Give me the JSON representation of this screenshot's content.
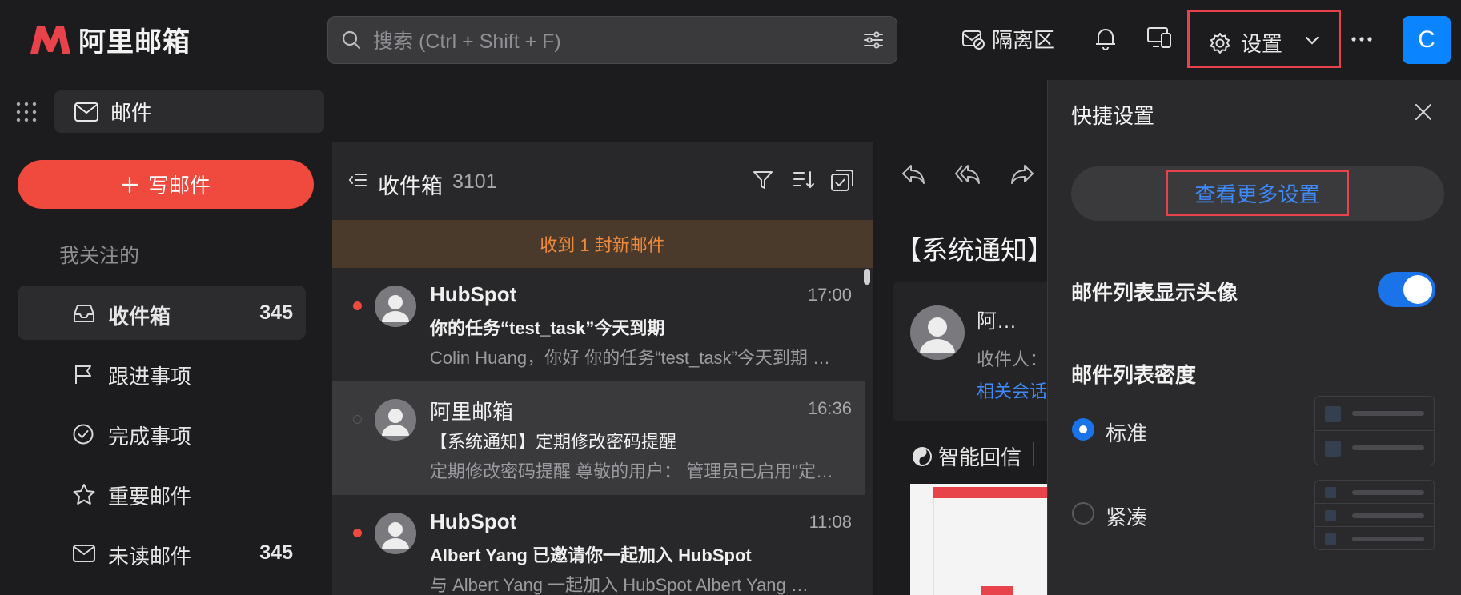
{
  "app": {
    "logo_text": "阿里邮箱",
    "brand_color": "#e8434b",
    "accent_color": "#1a73e8"
  },
  "topbar": {
    "search_placeholder": "搜索 (Ctrl + Shift + F)",
    "quarantine_label": "隔离区",
    "settings_label": "设置",
    "avatar_letter": "C"
  },
  "apptab": {
    "label": "邮件"
  },
  "sidebar": {
    "compose_label": "写邮件",
    "section_title": "我关注的",
    "items": [
      {
        "label": "收件箱",
        "count": "345",
        "icon": "inbox-icon"
      },
      {
        "label": "跟进事项",
        "count": "",
        "icon": "flag-icon"
      },
      {
        "label": "完成事项",
        "count": "",
        "icon": "check-circle-icon"
      },
      {
        "label": "重要邮件",
        "count": "",
        "icon": "star-icon"
      },
      {
        "label": "未读邮件",
        "count": "345",
        "icon": "mail-icon"
      }
    ]
  },
  "maillist": {
    "title": "收件箱",
    "count": "3101",
    "new_mail_banner": "收到 1 封新邮件",
    "rows": [
      {
        "sender": "HubSpot",
        "time": "17:00",
        "subject": "你的任务“test_task”今天到期",
        "preview": "Colin Huang，你好   你的任务“test_task”今天到期 …",
        "unread": true
      },
      {
        "sender": "阿里邮箱",
        "time": "16:36",
        "subject": "【系统通知】定期修改密码提醒",
        "preview": "定期修改密码提醒 尊敬的用户：   管理员已启用\"定…",
        "unread": false
      },
      {
        "sender": "HubSpot",
        "time": "11:08",
        "subject": "Albert Yang 已邀请你一起加入 HubSpot",
        "preview": "与 Albert Yang 一起加入 HubSpot     Albert Yang …",
        "unread": true
      }
    ]
  },
  "reader": {
    "subject": "【系统通知】",
    "sender_name": "阿…",
    "to_label": "收件人：",
    "related_label": "相关会话",
    "smart_reply_label": "智能回信"
  },
  "quick_settings": {
    "title": "快捷设置",
    "more_settings_label": "查看更多设置",
    "show_avatar_label": "邮件列表显示头像",
    "show_avatar_on": true,
    "density_label": "邮件列表密度",
    "density_options": [
      "标准",
      "紧凑"
    ],
    "density_selected": "标准"
  }
}
